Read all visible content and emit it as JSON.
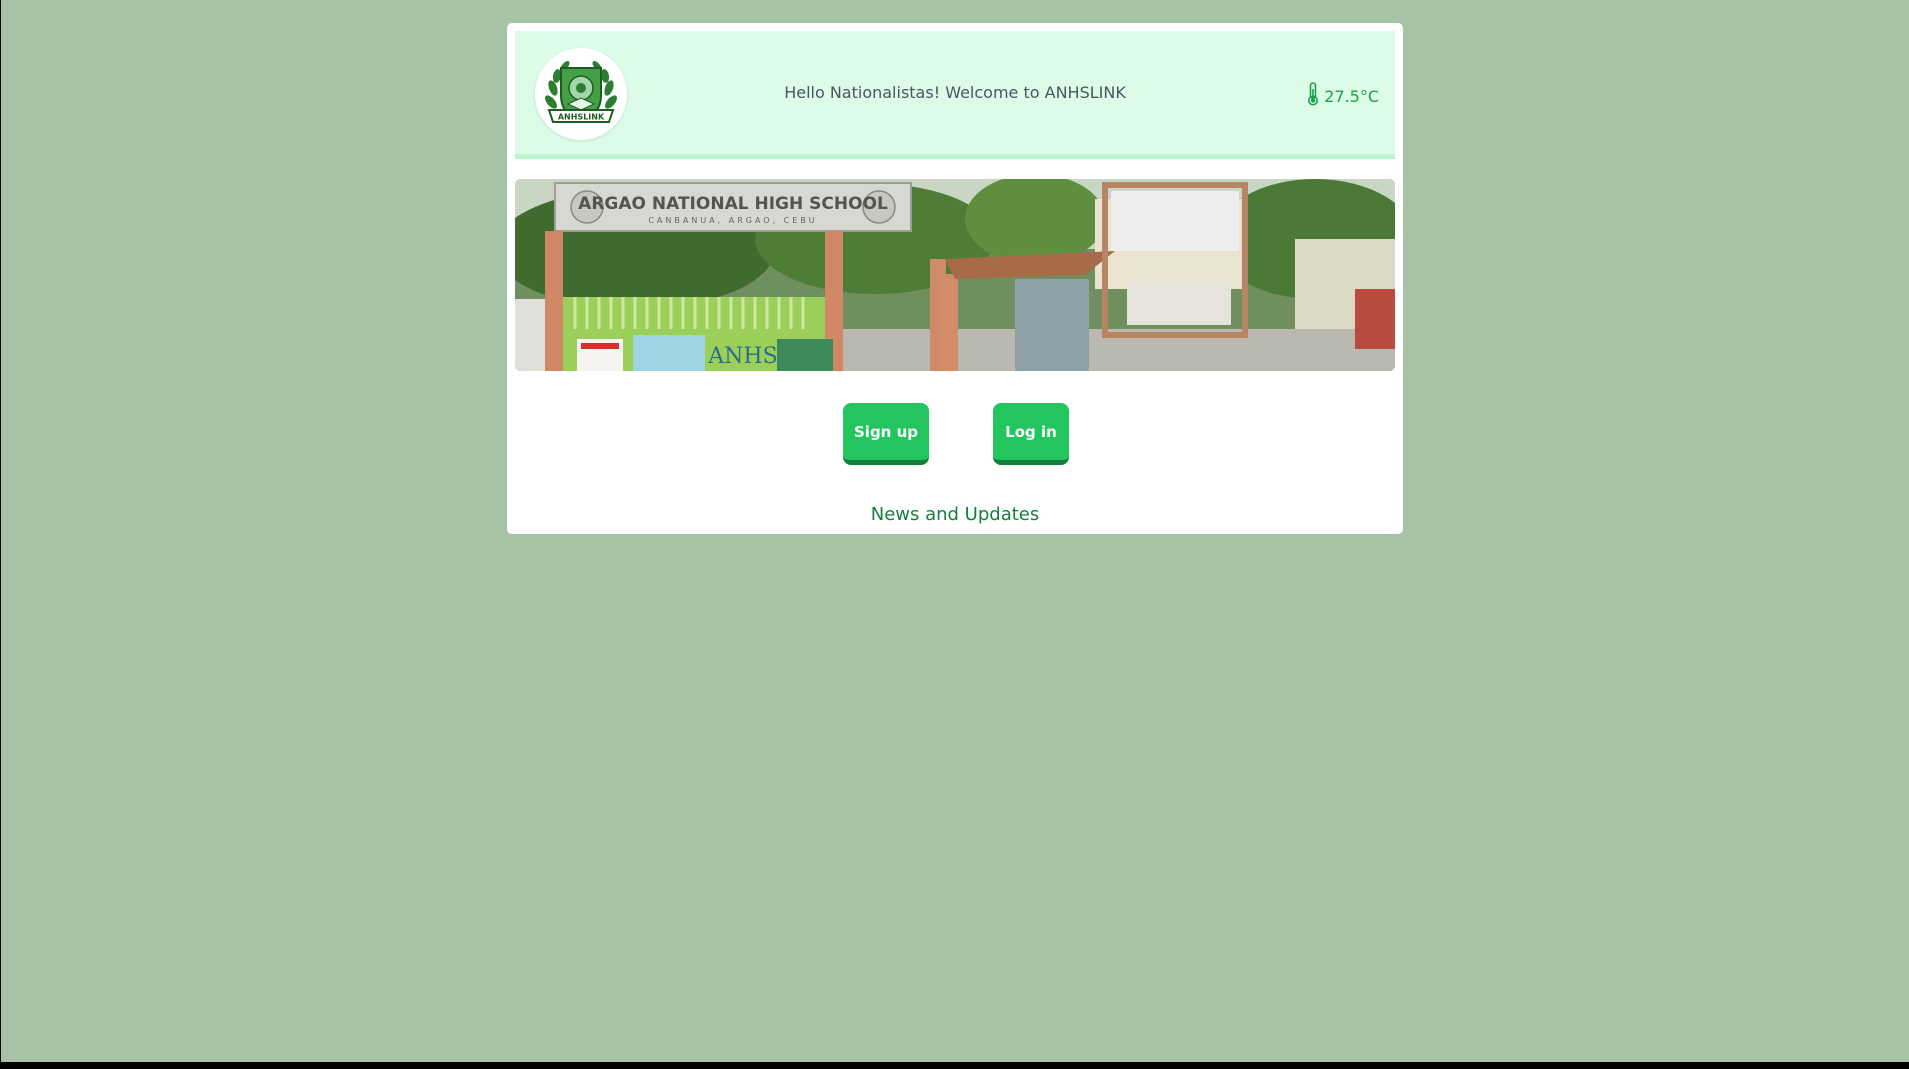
{
  "header": {
    "logo_text": "ANHSLINK",
    "welcome_text": "Hello Nationalistas! Welcome to ANHSLINK",
    "temperature": "27.5°C"
  },
  "banner": {
    "school_name": "ARGAO NATIONAL HIGH SCHOOL",
    "school_location": "CANBANUA, ARGAO, CEBU",
    "sign_text": "ANHS"
  },
  "actions": {
    "signup_label": "Sign up",
    "login_label": "Log in"
  },
  "news": {
    "title": "News and Updates"
  },
  "colors": {
    "page_background": "#a7c2a5",
    "header_background": "#dcfce7",
    "button_green": "#22c55e",
    "accent_text": "#15803d"
  },
  "icons": {
    "temperature": "thermometer-icon"
  }
}
